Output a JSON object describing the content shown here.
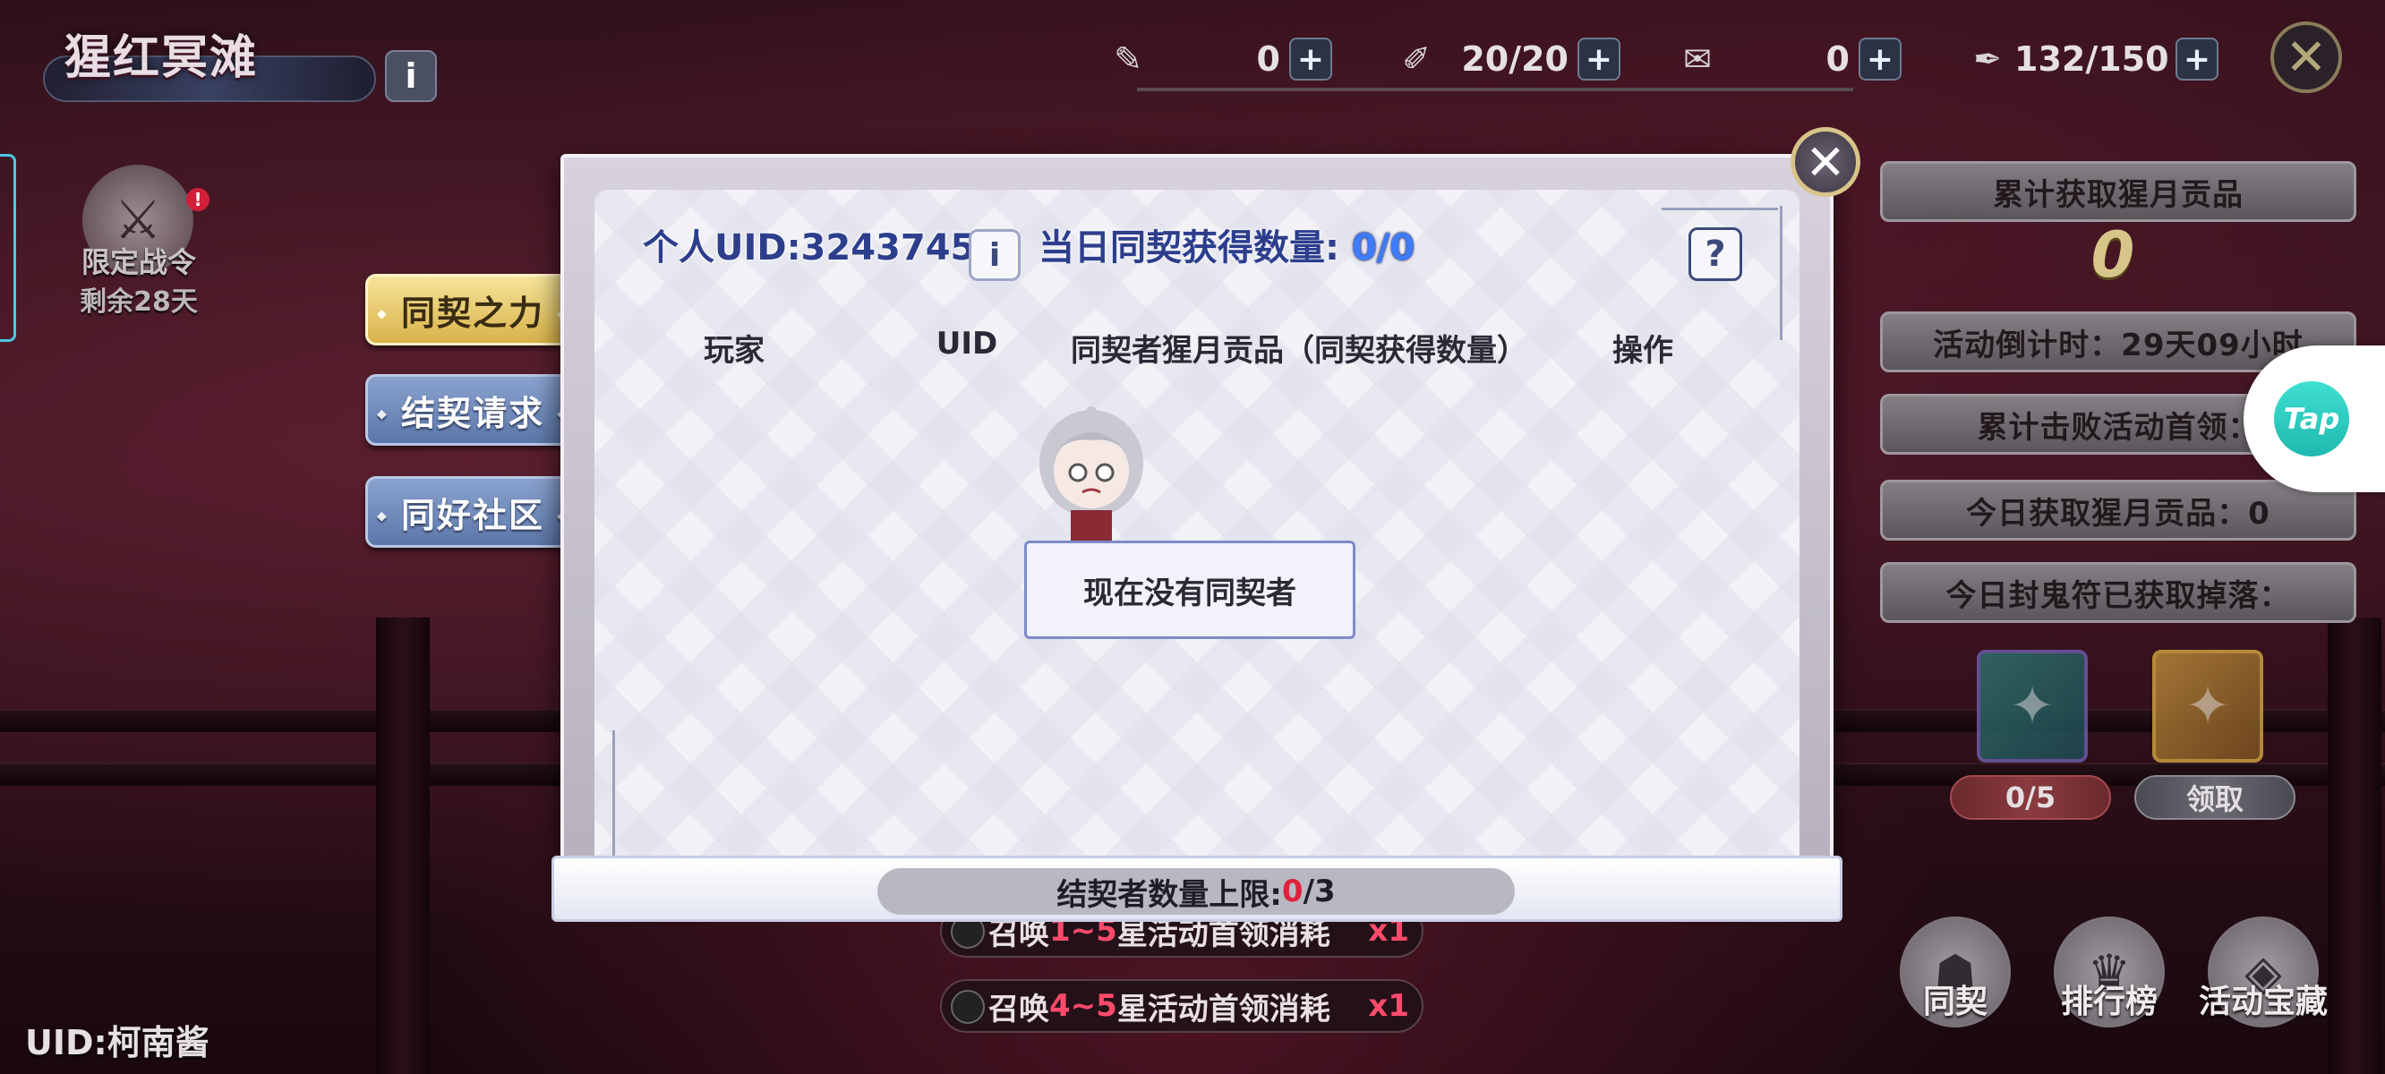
{
  "header": {
    "title": "猩红冥滩",
    "info_label": "i",
    "close_label": "✕"
  },
  "resources": [
    {
      "icon": "ticket-icon",
      "glyph": "✎",
      "value": "0",
      "plus": "+"
    },
    {
      "icon": "stamina-icon",
      "glyph": "✐",
      "value": "20/20",
      "plus": "+"
    },
    {
      "icon": "scroll-icon",
      "glyph": "✉",
      "value": "0",
      "plus": "+"
    },
    {
      "icon": "feather-icon",
      "glyph": "✒",
      "value": "132/150",
      "plus": "+"
    }
  ],
  "battle_pass": {
    "label": "限定战令",
    "remain": "剩余28天",
    "badge": "!"
  },
  "side_tabs": [
    {
      "label": "同契之力",
      "active": true
    },
    {
      "label": "结契请求",
      "active": false
    },
    {
      "label": "同好社区",
      "active": false
    }
  ],
  "footer_uid": "UID:柯南酱",
  "right_panel": {
    "total_title": "累计获取猩月贡品",
    "total_value": "0",
    "countdown": "活动倒计时：29天09小时",
    "bosses": "累计击败活动首领：",
    "today_tribute": "今日获取猩月贡品：0",
    "talisman": "今日封鬼符已获取掉落：",
    "card_progress": "0/5",
    "claim_label": "领取"
  },
  "bottom_buttons": [
    {
      "label": "同契",
      "icon": "partner-icon"
    },
    {
      "label": "排行榜",
      "icon": "ranking-icon"
    },
    {
      "label": "活动宝藏",
      "icon": "treasure-icon"
    }
  ],
  "tap_label": "Tap",
  "summon_rows": [
    {
      "prefix": "召唤",
      "range": "1~5",
      "suffix": "星活动首领消耗",
      "mult": "x1"
    },
    {
      "prefix": "召唤",
      "range": "4~5",
      "suffix": "星活动首领消耗",
      "mult": "x1"
    }
  ],
  "dialog": {
    "uid_label": "个人UID:3243745",
    "info_label": "i",
    "daily_label": "当日同契获得数量:",
    "daily_value": "0/0",
    "help_label": "?",
    "close_label": "✕",
    "columns": [
      "玩家",
      "UID",
      "同契者猩月贡品（同契获得数量）",
      "操作"
    ],
    "empty_message": "现在没有同契者",
    "limit_prefix": "结契者数量上限:",
    "limit_current": "0",
    "limit_max": "/3"
  }
}
